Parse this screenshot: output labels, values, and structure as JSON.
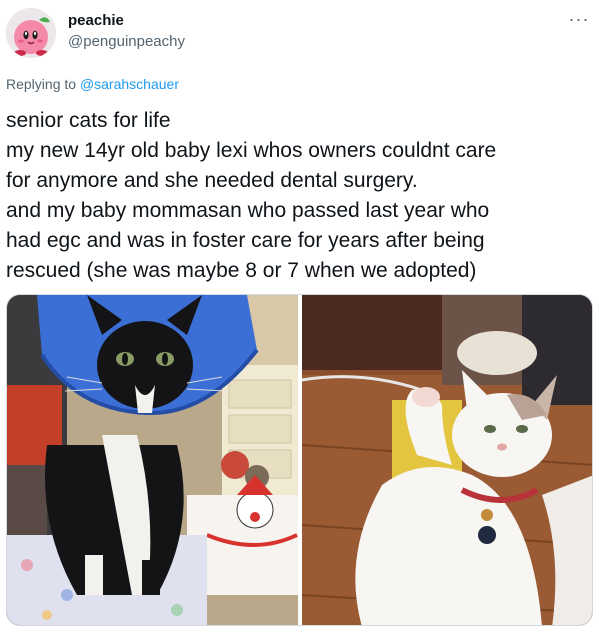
{
  "author": {
    "display_name": "peachie",
    "handle": "@penguinpeachy",
    "avatar_icon": "kirby-avatar-icon"
  },
  "reply": {
    "prefix": "Replying to ",
    "target": "@sarahschauer"
  },
  "tweet": {
    "lines": [
      "senior cats for life",
      "my new 14yr old baby lexi whos owners couldnt care",
      "for anymore and she needed dental surgery.",
      "and my baby mommasan who passed last year who",
      "had egc and was in foster care for years after being",
      "rescued (she was maybe 8 or 7 when we adopted)"
    ]
  },
  "menu": {
    "more_glyph": "···"
  },
  "media": {
    "photos": [
      "black-and-white-cat-with-blue-cone-photo",
      "white-cat-raising-paw-photo"
    ]
  },
  "colors": {
    "text": "#0f1419",
    "secondary": "#536471",
    "link": "#1d9bf0",
    "border": "#cfd9de"
  }
}
